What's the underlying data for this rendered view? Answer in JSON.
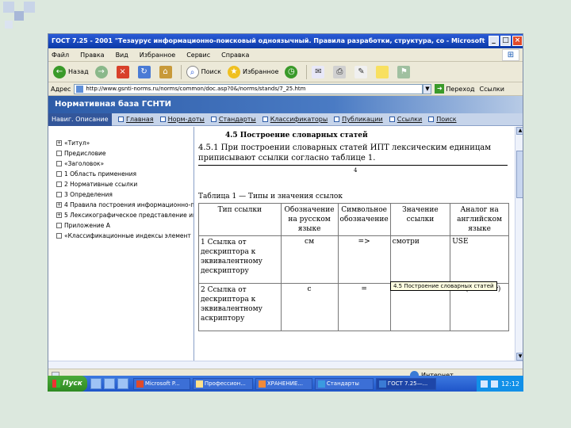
{
  "window": {
    "title": "ГОСТ 7.25 - 2001 \"Тезаурус информационно-поисковый одноязычный. Правила разработки, структура, со - Microsoft Inter...",
    "controls": [
      "_",
      "□",
      "×"
    ]
  },
  "menu": [
    "Файл",
    "Правка",
    "Вид",
    "Избранное",
    "Сервис",
    "Справка"
  ],
  "toolbar": {
    "back": "Назад",
    "search": "Поиск",
    "favorites": "Избранное"
  },
  "address": {
    "label": "Адрес",
    "value": "http://www.gsnti-norms.ru/norms/common/doc.asp?0&/norms/stands/7_25.htm",
    "go": "Переход",
    "links": "Ссылки"
  },
  "banner": "Нормативная база ГСНТИ",
  "nav": {
    "current": "Навиг. Описание",
    "links": [
      "Главная",
      "Норм-доты",
      "Стандарты",
      "Классификаторы",
      "Публикации",
      "Ссылки",
      "Поиск"
    ]
  },
  "tree": [
    {
      "mark": "+",
      "label": "«Титул»"
    },
    {
      "mark": "",
      "label": "Предисловие"
    },
    {
      "mark": "",
      "label": "«Заголовок»"
    },
    {
      "mark": "",
      "label": "1 Область применения"
    },
    {
      "mark": "",
      "label": "2 Нормативные ссылки"
    },
    {
      "mark": "",
      "label": "3 Определения"
    },
    {
      "mark": "+",
      "label": "4 Правила построения информационно-пои"
    },
    {
      "mark": "+",
      "label": "5 Лексикографическое представление инф"
    },
    {
      "mark": "",
      "label": "Приложение А"
    },
    {
      "mark": "",
      "label": "«Классификационные индексы элемент"
    }
  ],
  "content": {
    "section_title": "4.5 Построение словарных статей",
    "paragraph": "4.5.1 При построении словарных статей ИПТ лексическим единицам приписывают ссылки согласно таблице 1.",
    "hr_note": "4",
    "caption": "Таблица 1 — Типы и значения ссылок",
    "table": {
      "headers": [
        "Тип ссылки",
        "Обозначение на русском языке",
        "Символьное обозначение",
        "Значение ссылки",
        "Аналог на английском языке"
      ],
      "rows": [
        [
          "1 Ссылка от дескриптора к эквивалентному дескриптору",
          "см",
          "=>",
          "смотри",
          "USE"
        ],
        [
          "2 Ссылка от дескриптора к эквивалентному аскриптору",
          "с",
          "=",
          "синоним",
          "UF (used for)"
        ]
      ]
    },
    "tooltip": "4.5 Построение словарных статей"
  },
  "status": {
    "zone": "Интернет"
  },
  "taskbar": {
    "start": "Пуск",
    "tasks": [
      "Microsoft P...",
      "Профессион...",
      "ХРАНЕНИЕ...",
      "Стандарты",
      "ГОСТ 7.25—..."
    ],
    "time": "12:12"
  }
}
